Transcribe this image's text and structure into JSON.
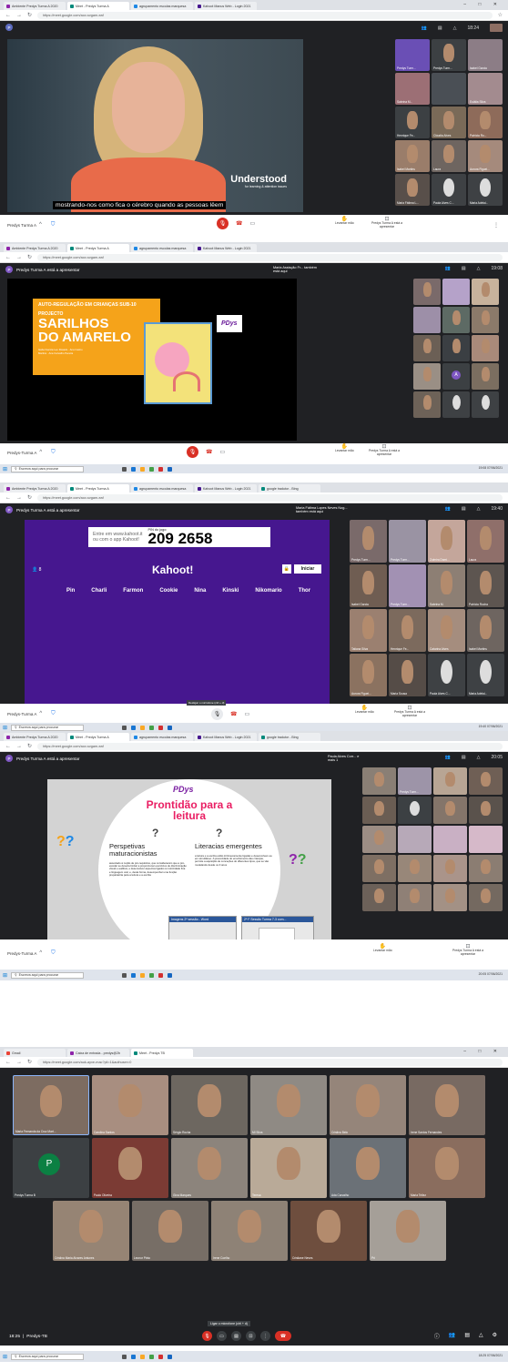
{
  "browser": {
    "tab_amb": "Ambiente Predys Turma A 2020",
    "tab_meet": "Meet - Predys Turma A",
    "tab_agrup": "agrupamento escolas marquesa",
    "tab_kahoot": "Kahoot Manus Web - Login 2021",
    "tab_tradutor": "google tradutor - Bing",
    "tab_gmail": "Gmail",
    "tab_caixa": "Caixa de entrada - predys@2b",
    "tab_meet_b": "Meet - Predys TB",
    "url1": "https://meet.google.com/aov-svgam-eaf",
    "url2": "https://meet.google.com/aov-svgam-eaf",
    "url3": "https://meet.google.com/aov-svgam-eaf",
    "url4": "https://meet.google.com/aov-svgam-eaf",
    "url5": "https://meet.google.com/auk-ayxe-mac?pli=1&authuser=0",
    "min": "–",
    "max": "□",
    "close": "✕"
  },
  "s1": {
    "presenter_initial": "P",
    "time": "18:24",
    "caption": "mostrando-nos como fica o cérebro quando as pessoas lêem",
    "brand": "Understood",
    "brand_sub": "for learning & attention issues",
    "meeting": "Predys Turma A",
    "raise_hand": "Levantar mão",
    "presenting": "Predys Turma A está a apresentar",
    "participants": [
      "Predys Turm...",
      "Predys Turm...",
      "Isabel Garcia",
      "Sabrina M...",
      "",
      "Eulália Silva",
      "Henrique Fe...",
      "Cláudia Alves",
      "Patrícia Ro...",
      "Isabel Martins",
      "Laura",
      "Aurora Figuei...",
      "Maria Fátima L...",
      "Paula Alves C...",
      "Maria Adelai..."
    ]
  },
  "s2": {
    "presenting": "Predys Turma A está a apresentar",
    "other": "Maria Assisção Fr... também está aqui",
    "time": "19:08",
    "slide_tag": "AUTO-REGULAÇÃO EM CRIANÇAS SUB-10",
    "slide_project": "PROJECTO",
    "slide_title1": "SARILHOS",
    "slide_title2": "DO AMARELO",
    "slide_authors": "Isabel Garcia Leo Rosado · Ana Castro Martins · Ana Carvalho Pereira",
    "logo": "PDys",
    "meeting": "Predys-Turma A",
    "raise_hand": "Levantar mão",
    "presenting_short": "Predys Turma A está a apresentar",
    "taskbar_search": "Escreva aqui para procurar",
    "clock": "19:08 07/06/2021",
    "participant_initial": "A"
  },
  "s3": {
    "presenting": "Predys Turma A está a apresentar",
    "other": "Maria Fátima Lopes Neves Nog... também está aqui",
    "time": "19:40",
    "pin_label": "PIN do jogo:",
    "enter_line1": "Entre em www.kahoot.it",
    "enter_line2": "ou com o app Kahoot!",
    "pin": "209 2658",
    "player_count": "8",
    "kahoot_logo": "Kahoot!",
    "start": "Iniciar",
    "players": [
      "Pin",
      "Charli",
      "Farmon",
      "Cookie",
      "Nina",
      "Kinski",
      "Nikomario",
      "Thor"
    ],
    "meeting": "Predys-Turma A",
    "tooltip": "Desligar o microfone (ctrl + d)",
    "raise_hand": "Levantar mão",
    "presenting_short": "Predys Turma A está a apresentar",
    "taskbar_search": "Escreva aqui para procurar",
    "clock": "19:40 07/06/2021",
    "participants": [
      "Predys Turm...",
      "Predys Turm...",
      "Zulmira Dami...",
      "Laura",
      "Isabel Garcia",
      "Predys Turm...",
      "Sabrina M.",
      "Patrícia Rocha",
      "Tatiana Silva",
      "Henrique Fe...",
      "Catarina Alves",
      "Isabel Martins",
      "Aurora Figuei...",
      "Maria Sousa",
      "Paula Alves C...",
      "Maria Adelai..."
    ]
  },
  "s4": {
    "presenting": "Predys Turma A está a apresentar",
    "other": "Paula Alves Corr... e mais 1",
    "time": "20:05",
    "slide_logo": "PDys",
    "slide_title": "Prontidão para a leitura",
    "col1_title": "Perspetivas maturacionistas",
    "col1_text": "associado à noção de pré-requisitos, que consideravam que a pré-escolar se deveria limitar a proporcionar exercícios de discriminação visual e auditiva, e desenvolver aspectos ligados à motricidade fina e linguagem oral, e, desta forma, desempenhar uma função preparatória para a leitura e a escrita",
    "col2_title": "Literacias emergentes",
    "col2_text": "a leitura e a escrita estão intrinsecamente ligadas e desenvolvem-se em simultâneo. A precocidade do envolvimento das crianças, permite a aquisição de conceções do diferentes tipos, que se vão modelando desde os 3 anos",
    "preview1": "Imagens 2ª sessão - Word",
    "preview2": "2ª F Sessão Turma 7-3 com...",
    "meeting": "Predys-Turma A",
    "raise_hand": "Levantar mão",
    "presenting_short": "Predys Turma A está a apresentar",
    "taskbar_search": "Escreva aqui para procurar",
    "clock": "20:05 07/06/2021",
    "participants": [
      "",
      "Predys Turm...",
      "",
      "",
      "",
      "",
      "",
      "",
      "",
      "",
      "",
      "",
      "",
      "",
      "",
      "",
      "",
      "",
      "",
      "",
      "",
      ""
    ]
  },
  "s5": {
    "time": "18:25",
    "meeting": "Predys-TB",
    "tooltip": "Ligar o microfone (ctrl + d)",
    "participant_initial": "P",
    "taskbar_search": "Escreva aqui para procurar",
    "clock": "18:25 07/06/2021",
    "tiles": [
      "Maria Fernanda da Cruz Mart...",
      "Carolina Santos",
      "Sérgio Rocha",
      "MI Silva",
      "Cristina Belo",
      "Irene Santos Fernandes",
      "Predys Turma B",
      "Paulo Oliveira",
      "Gina Marques",
      "Teresa",
      "Ada Carvalho",
      "Maria Tellez",
      "Cristina Maria Alvares Antunes",
      "Leonor Pinto",
      "Irene Coelho",
      "Cristiane Neves",
      "Pri"
    ]
  },
  "colors": {
    "meet_red": "#d93025",
    "kahoot_purple": "#46178f",
    "slide_orange": "#f5a31a",
    "meet_dark": "#202124"
  }
}
